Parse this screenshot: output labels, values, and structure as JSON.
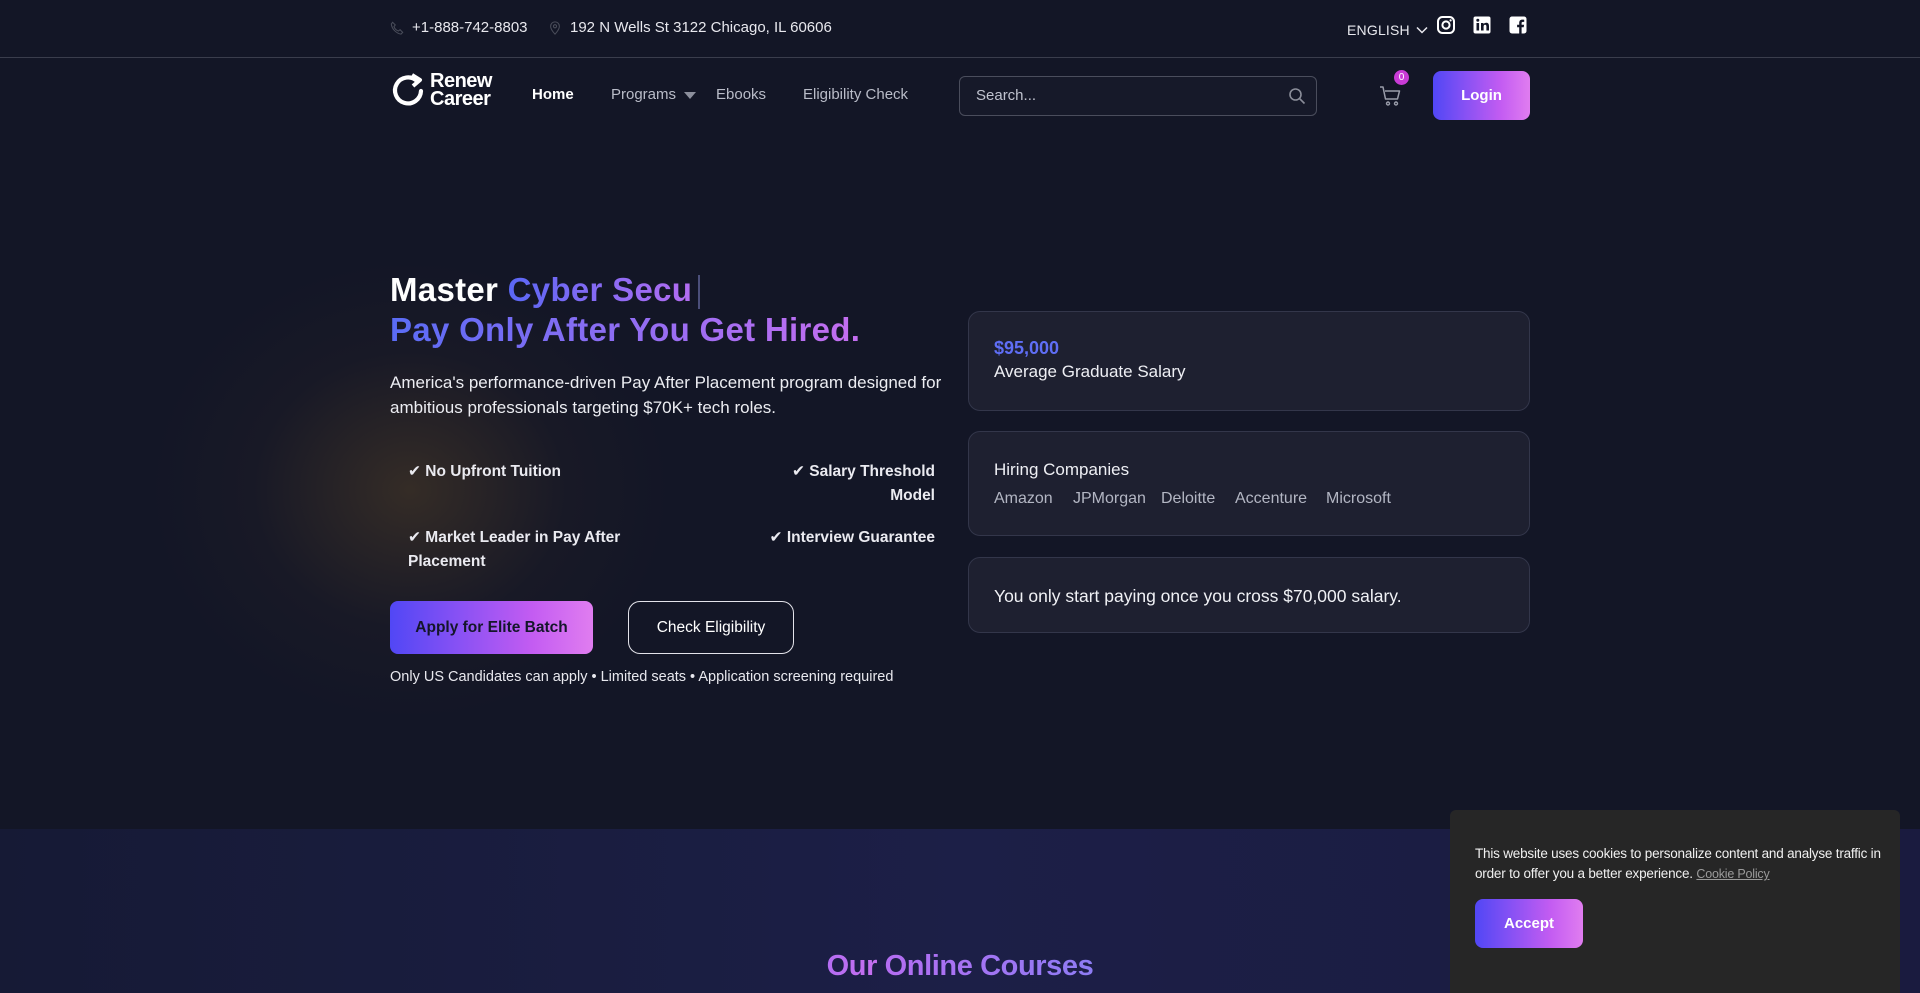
{
  "topbar": {
    "phone": "+1-888-742-8803",
    "address": "192 N Wells St 3122 Chicago, IL 60606",
    "language": "ENGLISH",
    "social": [
      "instagram-icon",
      "linkedin-icon",
      "facebook-icon"
    ]
  },
  "nav": {
    "logo_line1": "Renew",
    "logo_line2": "Career",
    "items": [
      "Home",
      "Programs",
      "Ebooks",
      "Eligibility Check"
    ],
    "search_placeholder": "Search...",
    "cart_count": "0",
    "login_label": "Login"
  },
  "hero": {
    "title_prefix": "Master",
    "title_highlight": "Cyber Secu",
    "subtitle": "Pay Only After You Get Hired.",
    "description": "America's performance-driven Pay After Placement program designed for ambitious professionals targeting $70K+ tech roles.",
    "features": [
      "✔ No Upfront Tuition",
      "✔ Salary Threshold Model",
      "✔ Market Leader in Pay After Placement",
      "✔ Interview Guarantee"
    ],
    "apply_label": "Apply for Elite Batch",
    "check_label": "Check Eligibility",
    "note": "Only US Candidates can apply • Limited seats • Application screening required"
  },
  "cards": {
    "salary_value": "$95,000",
    "salary_label": "Average Graduate Salary",
    "companies_title": "Hiring Companies",
    "companies": [
      "Amazon",
      "JPMorgan",
      "Deloitte",
      "Accenture",
      "Microsoft"
    ],
    "payment_text": "You only start paying once you cross $70,000 salary."
  },
  "courses": {
    "title_part1": "Our",
    "title_part2": "Online Courses"
  },
  "cookie": {
    "text": "This website uses cookies to personalize content and analyse traffic in order to offer you a better experience.",
    "link": "Cookie Policy",
    "accept_label": "Accept"
  },
  "colors": {
    "background": "#131626",
    "accent_start": "#5147f5",
    "accent_end": "#e07df0",
    "card": "#1e2030"
  }
}
